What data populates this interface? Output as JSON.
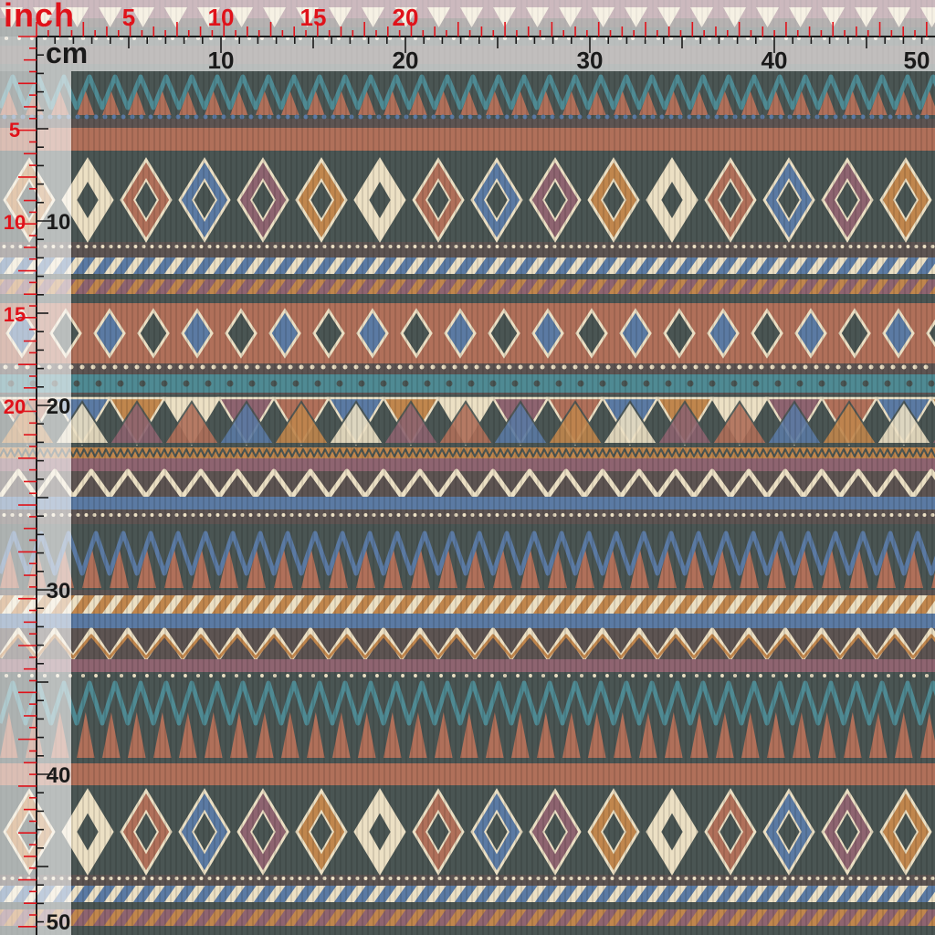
{
  "ruler": {
    "inch_unit": "inch",
    "cm_unit": "cm",
    "inch_ticks_top": [
      "5",
      "10",
      "15",
      "20"
    ],
    "cm_ticks_top": [
      "10",
      "20",
      "30",
      "40",
      "50"
    ],
    "inch_ticks_left": [
      "5",
      "10",
      "15",
      "20"
    ],
    "cm_ticks_left": [
      "10",
      "20",
      "30",
      "40",
      "50"
    ]
  },
  "colors": {
    "inch_ticks": "#e0121a",
    "cm_ticks": "#1a1a1a",
    "rust": "#b0705a",
    "teal": "#4f8a93",
    "slate": "#4a5553",
    "denim": "#5b7aa3",
    "cream": "#ece0c4",
    "mauve": "#8e6470",
    "ochre": "#c0864d"
  }
}
